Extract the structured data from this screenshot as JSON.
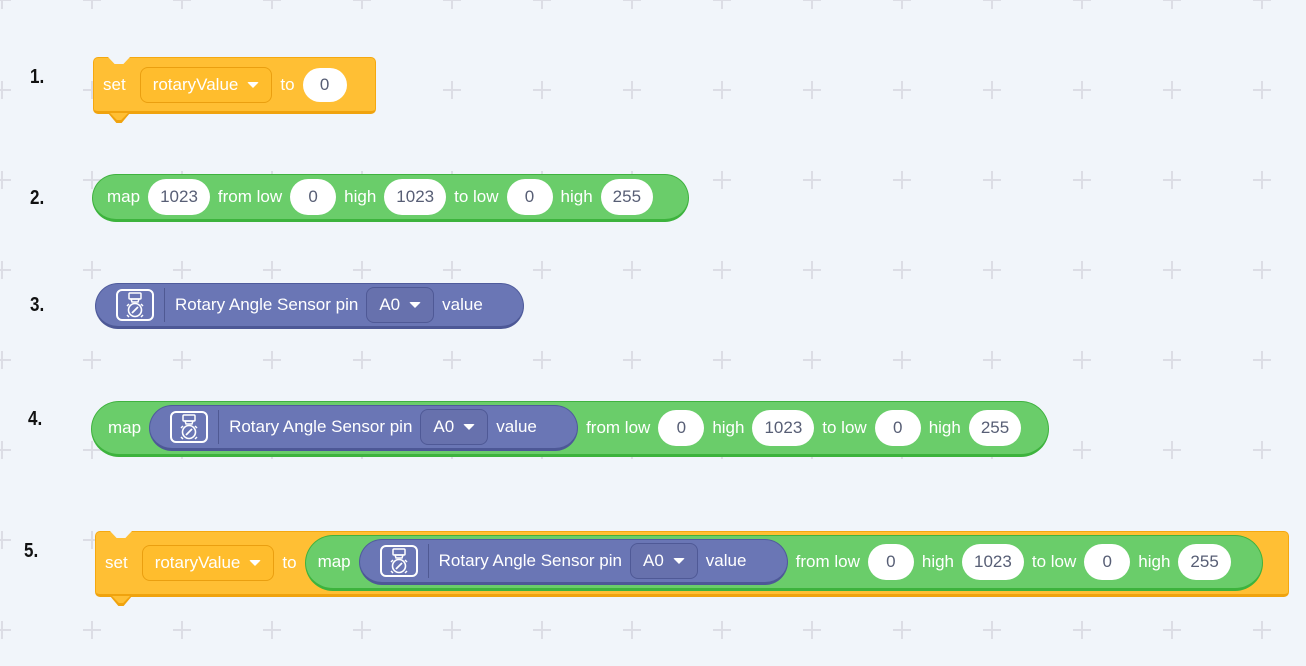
{
  "workspace": {
    "grid_marker": "plus",
    "colors": {
      "background": "#f1f5fa",
      "grid": "#dcdde5",
      "variables_block": "#ffbf34",
      "operators_block": "#6acd6a",
      "extension_block": "#6a76b5",
      "input_text": "#575e75"
    }
  },
  "examples": [
    {
      "number": "1.",
      "set_label": "set",
      "variable": "rotaryValue",
      "to_label": "to",
      "value": "0"
    },
    {
      "number": "2.",
      "map_label": "map",
      "input": "1023",
      "from_low_label": "from low",
      "from_low": "0",
      "from_high_label": "high",
      "from_high": "1023",
      "to_low_label": "to low",
      "to_low": "0",
      "to_high_label": "high",
      "to_high": "255"
    },
    {
      "number": "3.",
      "icon": "rotary-angle-sensor-icon",
      "sensor_label": "Rotary Angle Sensor pin",
      "pin": "A0",
      "value_label": "value"
    },
    {
      "number": "4.",
      "map_label": "map",
      "sensor_label": "Rotary Angle Sensor pin",
      "pin": "A0",
      "value_label": "value",
      "from_low_label": "from low",
      "from_low": "0",
      "from_high_label": "high",
      "from_high": "1023",
      "to_low_label": "to low",
      "to_low": "0",
      "to_high_label": "high",
      "to_high": "255"
    },
    {
      "number": "5.",
      "set_label": "set",
      "variable": "rotaryValue",
      "to_label": "to",
      "map_label": "map",
      "sensor_label": "Rotary Angle Sensor pin",
      "pin": "A0",
      "value_label": "value",
      "from_low_label": "from low",
      "from_low": "0",
      "from_high_label": "high",
      "from_high": "1023",
      "to_low_label": "to low",
      "to_low": "0",
      "to_high_label": "high",
      "to_high": "255"
    }
  ]
}
